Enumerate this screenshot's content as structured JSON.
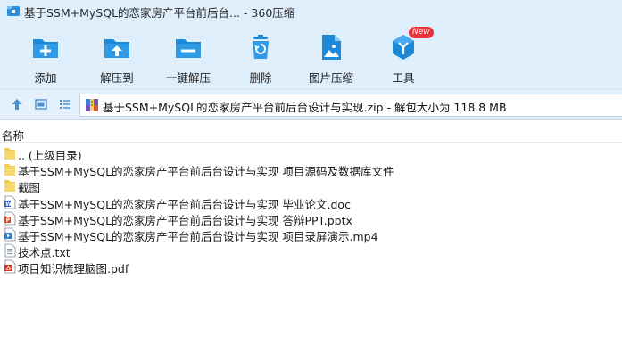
{
  "window": {
    "title": "基于SSM+MySQL的恋家房产平台前后台... - 360压缩"
  },
  "toolbar": {
    "buttons": [
      {
        "label": "添加",
        "icon": "add-icon"
      },
      {
        "label": "解压到",
        "icon": "extract-to-icon"
      },
      {
        "label": "一键解压",
        "icon": "one-click-extract-icon"
      },
      {
        "label": "删除",
        "icon": "delete-icon"
      },
      {
        "label": "图片压缩",
        "icon": "image-compress-icon"
      },
      {
        "label": "工具",
        "icon": "tools-icon",
        "badge": "New"
      }
    ]
  },
  "address": {
    "path": "基于SSM+MySQL的恋家房产平台前后台设计与实现.zip - 解包大小为 118.8 MB"
  },
  "list": {
    "column_name": "名称",
    "files": [
      {
        "name": ".. (上级目录)",
        "type": "folder"
      },
      {
        "name": "基于SSM+MySQL的恋家房产平台前后台设计与实现 项目源码及数据库文件",
        "type": "folder"
      },
      {
        "name": "截图",
        "type": "folder"
      },
      {
        "name": "基于SSM+MySQL的恋家房产平台前后台设计与实现 毕业论文.doc",
        "type": "doc"
      },
      {
        "name": "基于SSM+MySQL的恋家房产平台前后台设计与实现 答辩PPT.pptx",
        "type": "pptx"
      },
      {
        "name": "基于SSM+MySQL的恋家房产平台前后台设计与实现 项目录屏演示.mp4",
        "type": "mp4"
      },
      {
        "name": "技术点.txt",
        "type": "txt"
      },
      {
        "name": "项目知识梳理脑图.pdf",
        "type": "pdf"
      }
    ]
  },
  "colors": {
    "toolbar_bg": "#dfeefb",
    "icon_blue": "#1e88d8",
    "badge_red": "#e8343c"
  }
}
